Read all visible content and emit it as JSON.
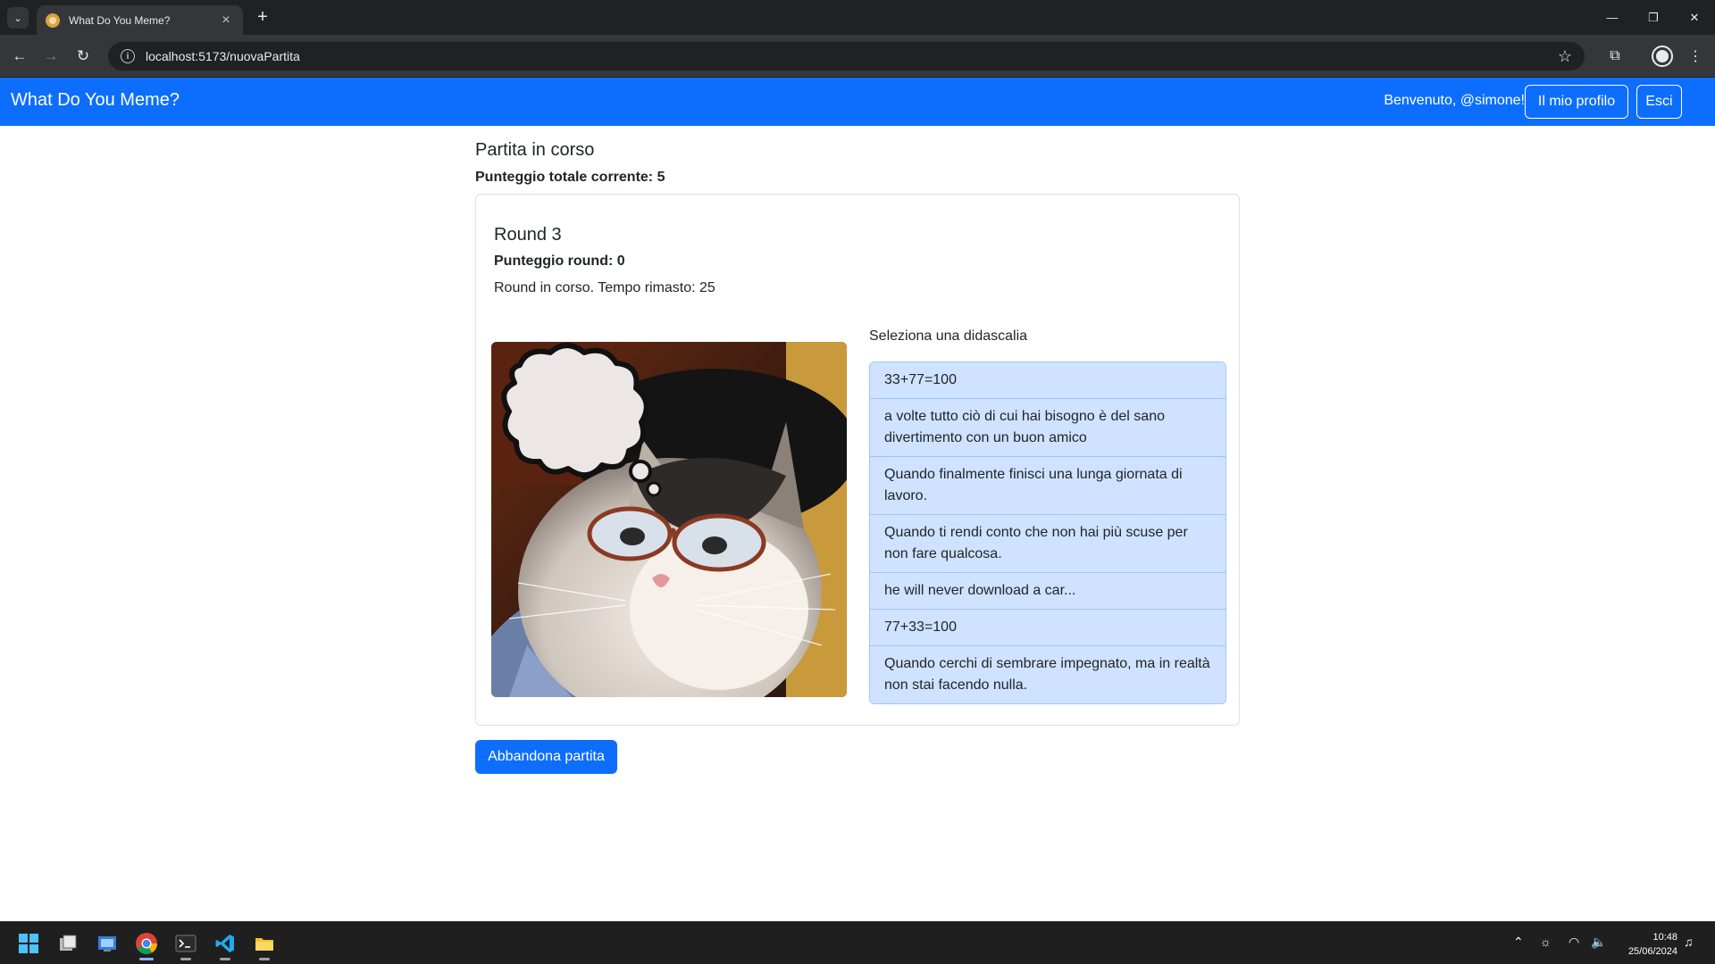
{
  "browser": {
    "tab_title": "What Do You Meme?",
    "url": "localhost:5173/nuovaPartita"
  },
  "navbar": {
    "brand": "What Do You Meme?",
    "welcome": "Benvenuto, @simone!",
    "profile_button": "Il mio profilo",
    "logout_button": "Esci"
  },
  "game": {
    "heading": "Partita in corso",
    "total_score": "Punteggio totale corrente: 5",
    "round": {
      "title": "Round 3",
      "score": "Punteggio round: 0",
      "status": "Round in corso. Tempo rimasto: 25"
    },
    "caption_prompt": "Seleziona una didascalia",
    "captions": [
      "33+77=100",
      "a volte tutto ciò di cui hai bisogno è del sano divertimento con un buon amico",
      "Quando finalmente finisci una lunga giornata di lavoro.",
      "Quando ti rendi conto che non hai più scuse per non fare qualcosa.",
      "he will never download a car...",
      "77+33=100",
      "Quando cerchi di sembrare impegnato, ma in realtà non stai facendo nulla."
    ],
    "abandon_button": "Abbandona partita"
  },
  "taskbar": {
    "time": "10:48",
    "date": "25/06/2024"
  },
  "colors": {
    "primary": "#0d6efd",
    "caption_bg": "#cfe2ff",
    "caption_border": "#9ec5fe"
  }
}
